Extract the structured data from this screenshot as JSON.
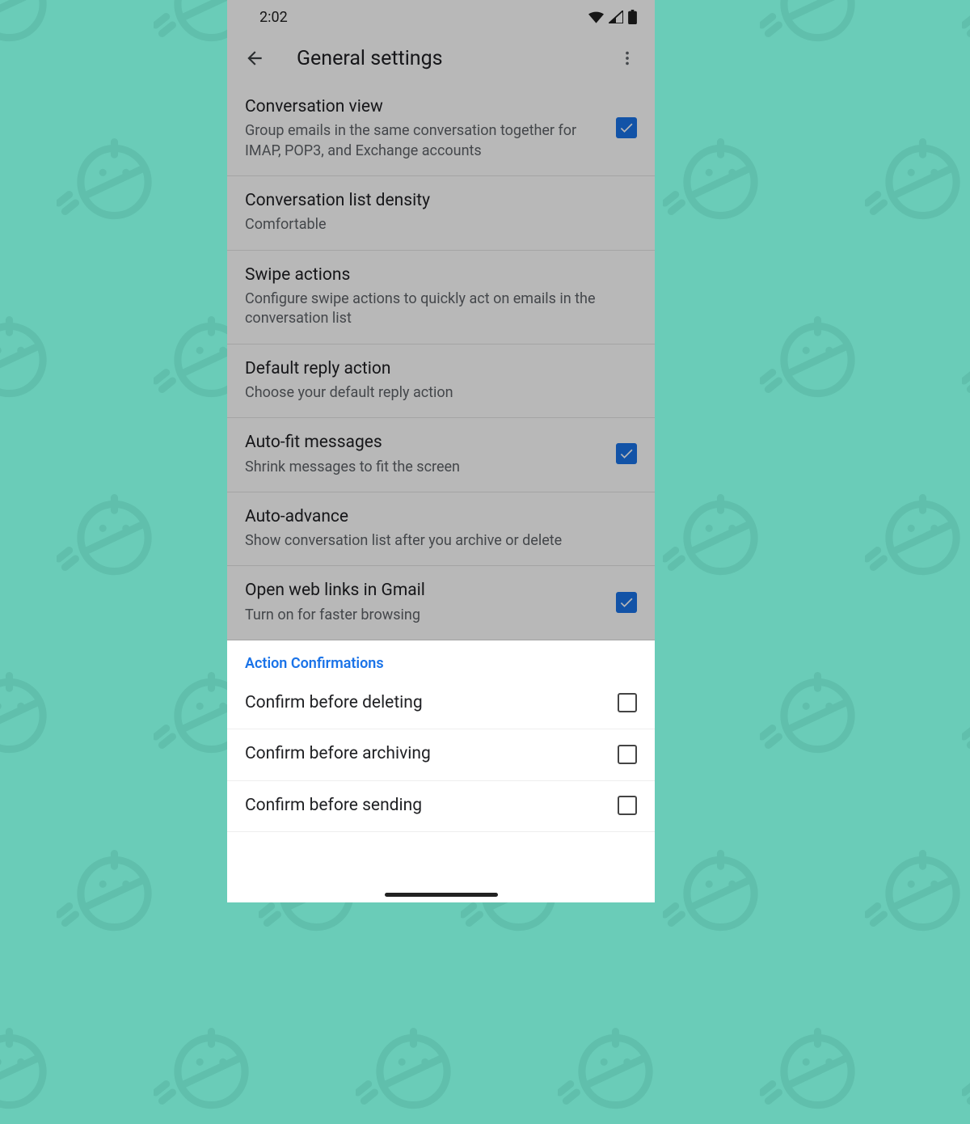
{
  "status_bar": {
    "time": "2:02"
  },
  "app_bar": {
    "title": "General settings"
  },
  "settings": [
    {
      "title": "Conversation view",
      "subtitle": "Group emails in the same conversation together for IMAP, POP3, and Exchange accounts",
      "checked": true,
      "has_checkbox": true
    },
    {
      "title": "Conversation list density",
      "subtitle": "Comfortable",
      "has_checkbox": false
    },
    {
      "title": "Swipe actions",
      "subtitle": "Configure swipe actions to quickly act on emails in the conversation list",
      "has_checkbox": false
    },
    {
      "title": "Default reply action",
      "subtitle": "Choose your default reply action",
      "has_checkbox": false
    },
    {
      "title": "Auto-fit messages",
      "subtitle": "Shrink messages to fit the screen",
      "checked": true,
      "has_checkbox": true
    },
    {
      "title": "Auto-advance",
      "subtitle": "Show conversation list after you archive or delete",
      "has_checkbox": false
    },
    {
      "title": "Open web links in Gmail",
      "subtitle": "Turn on for faster browsing",
      "checked": true,
      "has_checkbox": true
    }
  ],
  "section_header": "Action Confirmations",
  "confirmations": [
    {
      "title": "Confirm before deleting",
      "checked": false
    },
    {
      "title": "Confirm before archiving",
      "checked": false
    },
    {
      "title": "Confirm before sending",
      "checked": false
    }
  ]
}
